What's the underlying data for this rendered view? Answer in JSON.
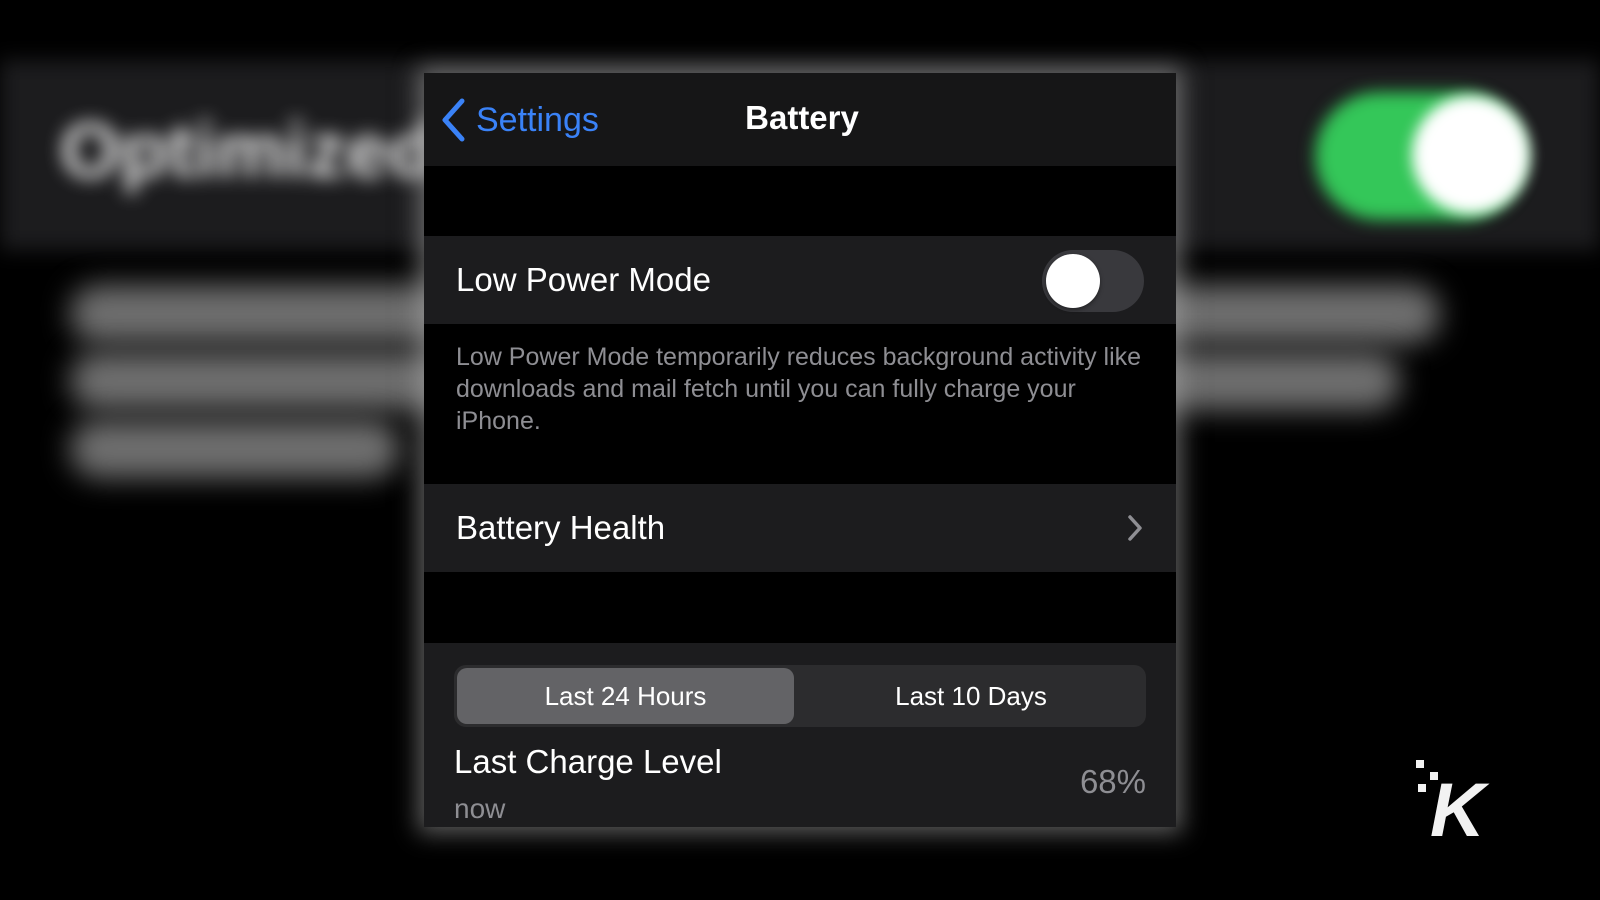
{
  "nav": {
    "back_label": "Settings",
    "title": "Battery"
  },
  "low_power": {
    "label": "Low Power Mode",
    "enabled": false,
    "footnote": "Low Power Mode temporarily reduces background activity like downloads and mail fetch until you can fully charge your iPhone."
  },
  "battery_health": {
    "label": "Battery Health"
  },
  "usage": {
    "segments": [
      "Last 24 Hours",
      "Last 10 Days"
    ],
    "selected_segment": "Last 24 Hours",
    "last_charge_label": "Last Charge Level",
    "last_charge_time": "now",
    "last_charge_value": "68%"
  },
  "watermark": {
    "text": "K"
  },
  "colors": {
    "accent": "#3a82f7",
    "background_toggle_on": "#34c759",
    "cell_background": "#1c1c1e",
    "secondary_text": "#8e8e93"
  },
  "icons": {
    "back": "chevron-left-icon",
    "disclosure": "chevron-right-icon"
  }
}
